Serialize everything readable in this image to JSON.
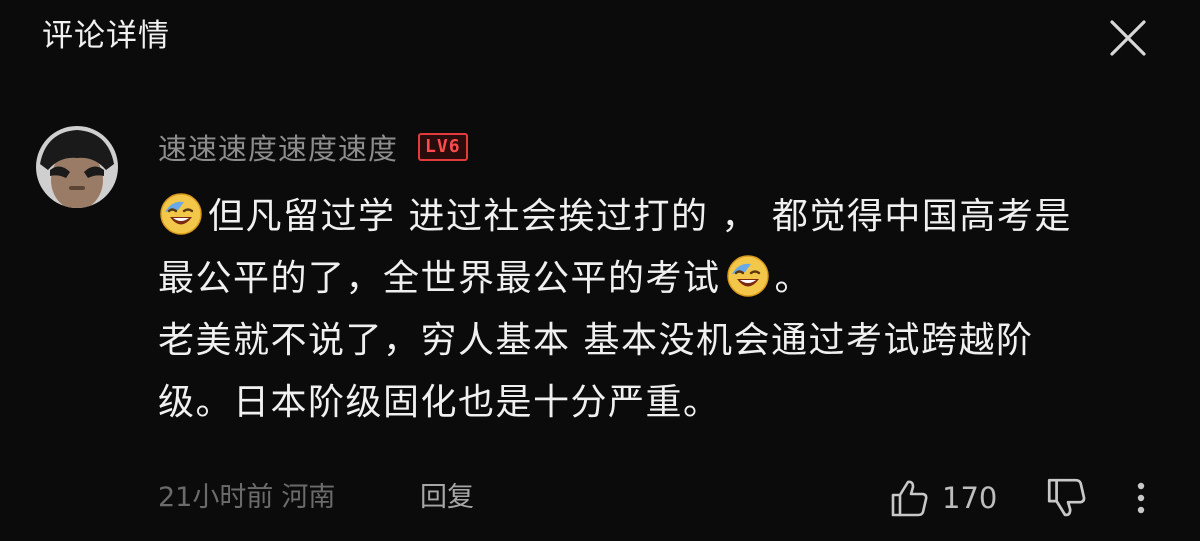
{
  "header": {
    "title": "评论详情",
    "close_icon": "close-icon"
  },
  "comment": {
    "username": "速速速度速度速度",
    "level_badge": "LV6",
    "lines": [
      "但凡留过学 进过社会挨过打的 ， 都觉得中国高考是",
      "最公平的了，全世界最公平的考试",
      "。",
      "老美就不说了，穷人基本 基本没机会通过考试跨越阶",
      "级。日本阶级固化也是十分严重。"
    ],
    "emoji": "grinning-sweat-emoji",
    "time": "21小时前",
    "location": "河南",
    "reply_label": "回复",
    "like_count": "170"
  },
  "colors": {
    "background": "#0b0b0b",
    "username": "#8d8d8d",
    "badge": "#e23b3b",
    "text": "#f0f0f0",
    "meta": "#6b6b6b"
  }
}
